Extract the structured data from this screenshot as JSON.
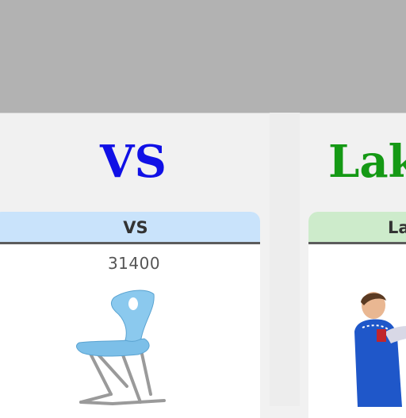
{
  "brands": {
    "left": "VS",
    "right": "Lak"
  },
  "cards": [
    {
      "header": "VS",
      "price": "31400",
      "image": "blue-chair-image"
    },
    {
      "header": "La",
      "image": "child-in-blue-apron-image"
    }
  ],
  "colors": {
    "vs_brand": "#1010e6",
    "lak_brand": "#159915",
    "vs_header_bg": "#c9e3fb",
    "lak_header_bg": "#cdebcb"
  }
}
